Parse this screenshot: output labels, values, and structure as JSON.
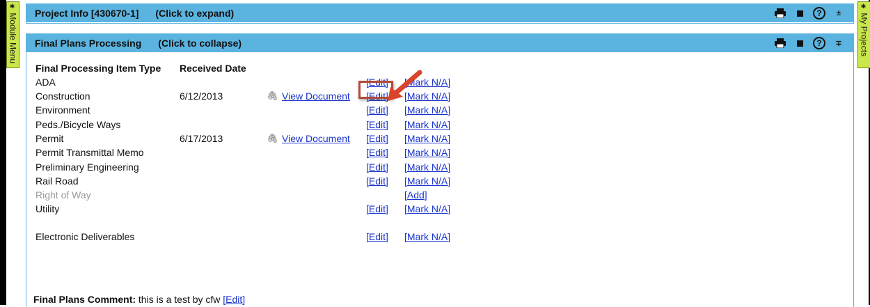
{
  "side_tabs": {
    "left_label": "Module Menu",
    "right_label": "My Projects"
  },
  "project_panel": {
    "title": "Project Info [430670-1]",
    "hint": "(Click to expand)",
    "toggle_symbol": "±"
  },
  "plans_panel": {
    "title": "Final Plans Processing",
    "hint": "(Click to collapse)",
    "toggle_symbol": "∓",
    "columns": {
      "type": "Final Processing Item Type",
      "date": "Received Date"
    },
    "rows": [
      {
        "type": "ADA",
        "date": "",
        "doc": "",
        "edit": "[Edit]",
        "mark": "[Mark N/A]",
        "muted": false
      },
      {
        "type": "Construction",
        "date": "6/12/2013",
        "doc": "View Document",
        "edit": "[Edit]",
        "mark": "[Mark N/A]",
        "muted": false
      },
      {
        "type": "Environment",
        "date": "",
        "doc": "",
        "edit": "[Edit]",
        "mark": "[Mark N/A]",
        "muted": false
      },
      {
        "type": "Peds./Bicycle Ways",
        "date": "",
        "doc": "",
        "edit": "[Edit]",
        "mark": "[Mark N/A]",
        "muted": false
      },
      {
        "type": "Permit",
        "date": "6/17/2013",
        "doc": "View Document",
        "edit": "[Edit]",
        "mark": "[Mark N/A]",
        "muted": false
      },
      {
        "type": "Permit Transmittal Memo",
        "date": "",
        "doc": "",
        "edit": "[Edit]",
        "mark": "[Mark N/A]",
        "muted": false
      },
      {
        "type": "Preliminary Engineering",
        "date": "",
        "doc": "",
        "edit": "[Edit]",
        "mark": "[Mark N/A]",
        "muted": false
      },
      {
        "type": "Rail Road",
        "date": "",
        "doc": "",
        "edit": "[Edit]",
        "mark": "[Mark N/A]",
        "muted": false
      },
      {
        "type": "Right of Way",
        "date": "",
        "doc": "",
        "edit": "",
        "mark": "[Add]",
        "muted": true
      },
      {
        "type": "Utility",
        "date": "",
        "doc": "",
        "edit": "[Edit]",
        "mark": "[Mark N/A]",
        "muted": false
      },
      {
        "type": "Electronic Deliverables",
        "date": "",
        "doc": "",
        "edit": "[Edit]",
        "mark": "[Mark N/A]",
        "muted": false
      }
    ],
    "comment": {
      "label": "Final Plans Comment:",
      "text": "this is a test by cfw",
      "edit": "[Edit]"
    }
  },
  "colors": {
    "header_blue": "#5bb3df",
    "tab_green": "#c9e64a",
    "link_blue": "#1a33cc",
    "highlight_red": "#b44a3a",
    "arrow_red": "#d9452c"
  },
  "icons": [
    "printer-icon",
    "stop-icon",
    "help-icon",
    "toggle-icon",
    "paperclip-icon",
    "arrow-icon",
    "pin-icon"
  ]
}
